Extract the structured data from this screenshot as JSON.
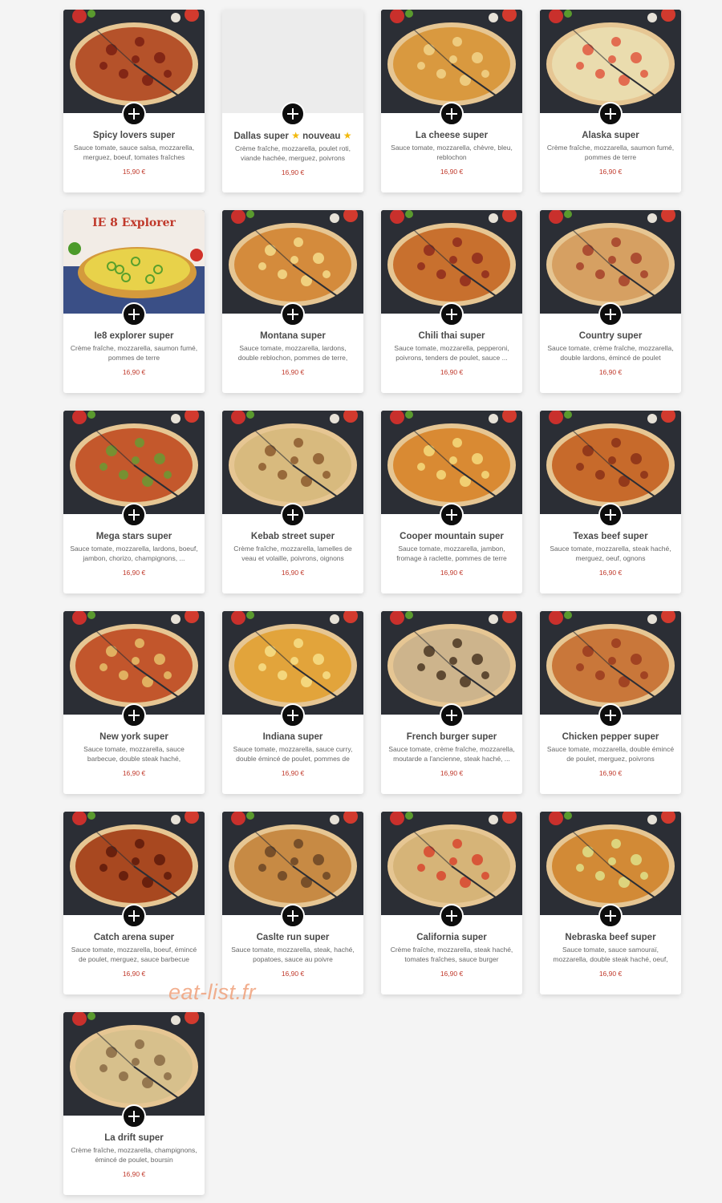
{
  "pizzas": [
    {
      "name": "Spicy lovers super",
      "desc": "Sauce tomate, sauce salsa, mozzarella, merguez, boeuf, tomates fraîches",
      "price": "15,90 €",
      "tone": "#b5522a",
      "topping": "#7a1e12"
    },
    {
      "name_prefix": "Dallas super",
      "badge_text": "nouveau",
      "badge_icon": "star-icon",
      "desc": "Crème fraîche, mozzarella, poulet roti, viande hachée, merguez, poivrons",
      "price": "16,90 €",
      "empty_photo": true
    },
    {
      "name": "La cheese super",
      "desc": "Sauce tomate, mozzarella, chèvre, bleu, reblochon",
      "price": "16,90 €",
      "tone": "#d9993f",
      "topping": "#f1d489"
    },
    {
      "name": "Alaska super",
      "desc": "Crème fraîche, mozzarella, saumon fumé, pommes de terre",
      "price": "16,90 €",
      "tone": "#eadcae",
      "topping": "#e0583f"
    },
    {
      "name": "Ie8 explorer super",
      "desc": "Crème fraîche, mozzarella, saumon fumé, pommes de terre",
      "price": "16,90 €",
      "tone": "#e8d24a",
      "topping": "#5aa02c",
      "banner": "IE 8 Explorer"
    },
    {
      "name": "Montana super",
      "desc": "Sauce tomate, mozzarella, lardons, double reblochon, pommes de terre, oignons",
      "price": "16,90 €",
      "tone": "#d48b3c",
      "topping": "#f4dc8a"
    },
    {
      "name": "Chili thai super",
      "desc": "Sauce tomate, mozzarella, pepperoni, poivrons, tenders de poulet, sauce ...",
      "price": "16,90 €",
      "tone": "#c8702e",
      "topping": "#8e2a1c"
    },
    {
      "name": "Country super",
      "desc": "Sauce tomate, crème fraîche, mozzarella, double lardons, émincé de poulet",
      "price": "16,90 €",
      "tone": "#d6a062",
      "topping": "#a4402a"
    },
    {
      "name": "Mega stars super",
      "desc": "Sauce tomate, mozzarella, lardons, boeuf, jambon, chorizo, champignons, ...",
      "price": "16,90 €",
      "tone": "#c4582c",
      "topping": "#6a9a34"
    },
    {
      "name": "Kebab street super",
      "desc": "Crème fraîche, mozzarella, lamelles de veau et volaille, poivrons, oignons",
      "price": "16,90 €",
      "tone": "#d8ba7e",
      "topping": "#8c5a2e"
    },
    {
      "name": "Cooper mountain super",
      "desc": "Sauce tomate, mozzarella, jambon, fromage à raclette, pommes de terre",
      "price": "16,90 €",
      "tone": "#d98a33",
      "topping": "#f5da7e"
    },
    {
      "name": "Texas beef super",
      "desc": "Sauce tomate, mozzarella, steak haché, merguez, oeuf, ognons",
      "price": "16,90 €",
      "tone": "#c76a2b",
      "topping": "#8a3018"
    },
    {
      "name": "New york super",
      "desc": "Sauce tomate, mozzarella, sauce barbecue, double steak haché, cornichons, ognons",
      "price": "16,90 €",
      "tone": "#c2562c",
      "topping": "#e6c06a"
    },
    {
      "name": "Indiana super",
      "desc": "Sauce tomate, mozzarella, sauce curry, double émincé de poulet, pommes de terre",
      "price": "16,90 €",
      "tone": "#e2a43b",
      "topping": "#f7e08a"
    },
    {
      "name": "French burger super",
      "desc": "Sauce tomate, crème fraîche, mozzarella, moutarde a l'ancienne, steak haché, ...",
      "price": "16,90 €",
      "tone": "#cdb48c",
      "topping": "#4a3622"
    },
    {
      "name": "Chicken pepper super",
      "desc": "Sauce tomate, mozzarella, double émincé de poulet, merguez, poivrons",
      "price": "16,90 €",
      "tone": "#c9773a",
      "topping": "#9a3a1e"
    },
    {
      "name": "Catch arena super",
      "desc": "Sauce tomate, mozzarella, boeuf, émincé de poulet, merguez, sauce barbecue",
      "price": "16,90 €",
      "tone": "#a84820",
      "topping": "#5e1a0a"
    },
    {
      "name": "Caslte run super",
      "desc": "Sauce tomate, mozzarella, steak, haché, popatoes, sauce au poivre",
      "price": "16,90 €",
      "tone": "#c78a44",
      "topping": "#6a4424"
    },
    {
      "name": "California super",
      "desc": "Crème fraîche, mozzarella, steak haché, tomates fraîches, sauce burger",
      "price": "16,90 €",
      "tone": "#d6b478",
      "topping": "#d8452e"
    },
    {
      "name": "Nebraska beef super",
      "desc": "Sauce tomate, sauce samouraï, mozzarella, double steak haché, oeuf, pommes de ...",
      "price": "16,90 €",
      "tone": "#d28a36",
      "topping": "#dfe08a"
    },
    {
      "name": "La drift super",
      "desc": "Crème fraîche, mozzarella, champignons, émincé de poulet, boursin",
      "price": "16,90 €",
      "tone": "#d7c08c",
      "topping": "#8a6a44"
    }
  ],
  "watermark": "eat-list.fr"
}
